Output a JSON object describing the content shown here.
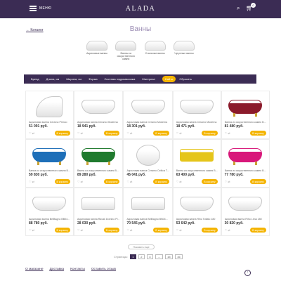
{
  "header": {
    "menu_label": "МЕНЮ",
    "logo": "ALADA",
    "cart_count": "0",
    "search_icon": "search-icon",
    "cart_icon": "cart-icon"
  },
  "breadcrumb": {
    "back_label": "← Каталог"
  },
  "page": {
    "title": "Ванны"
  },
  "categories": [
    {
      "label": "Акриловые ванны"
    },
    {
      "label": "Ванны из искусственного камня"
    },
    {
      "label": "Стальные ванны"
    },
    {
      "label": "Чугунные ванны"
    }
  ],
  "filters": {
    "items": [
      "Бренд",
      "Длина, см",
      "Ширина, см",
      "Форма",
      "Система гидромассажа",
      "Материал"
    ],
    "apply_label": "Найти",
    "reset_label": "Сбросить"
  },
  "products": [
    {
      "name": "Акриловая ванна Ceramo Plenco",
      "price": "51 091 руб.",
      "color": "#ffffff",
      "shape": "corner"
    },
    {
      "name": "Акриловая ванна Ceramo Moderna",
      "price": "18 941 руб.",
      "color": "#ffffff",
      "shape": "oval"
    },
    {
      "name": "Акриловая ванна Ceramo Moderna",
      "price": "18 301 руб.",
      "color": "#ffffff",
      "shape": "oval"
    },
    {
      "name": "Акриловая ванна Ceramo Moderna",
      "price": "18 471 руб.",
      "color": "#ffffff",
      "shape": "oval"
    },
    {
      "name": "Ванна из искусственного камня В...",
      "price": "81 480 руб.",
      "color": "#8b1a2b",
      "shape": "claw"
    },
    {
      "name": "Ванна из искусственного камня В...",
      "price": "59 830 руб.",
      "color": "#1e6fb8",
      "shape": "claw"
    },
    {
      "name": "Ванна из искусственного камня В...",
      "price": "89 280 руб.",
      "color": "#1f7a2e",
      "shape": "claw"
    },
    {
      "name": "Акриловая ванна Ceramo Celtica T...",
      "price": "45 041 руб.",
      "color": "#ffffff",
      "shape": "round"
    },
    {
      "name": "Ванна из искусственного камня В...",
      "price": "63 400 руб.",
      "color": "#e5c51a",
      "shape": "rect"
    },
    {
      "name": "Ванна из искусственного камня В...",
      "price": "77 780 руб.",
      "color": "#d8187a",
      "shape": "claw"
    },
    {
      "name": "Акриловая ванна BelBagno BB04...",
      "price": "88 780 руб.",
      "color": "#ffffff",
      "shape": "oval"
    },
    {
      "name": "Акриловая ванна Ravak Domino Pl...",
      "price": "28 030 руб.",
      "color": "#ffffff",
      "shape": "rect"
    },
    {
      "name": "Акриловая ванна BelBagno BB04...",
      "price": "70 545 руб.",
      "color": "#ffffff",
      "shape": "rect"
    },
    {
      "name": "Акриловая ванна Riho Totlato 180",
      "price": "53 642 руб.",
      "color": "#ffffff",
      "shape": "oval"
    },
    {
      "name": "Акриловая ванна Riho Lima 180",
      "price": "30 820 руб.",
      "color": "#ffffff",
      "shape": "oval"
    }
  ],
  "card": {
    "cart_label": "В корзину",
    "icons": "♡ ⇄"
  },
  "pagination": {
    "show_more_label": "Показать еще",
    "label": "Страницы:",
    "pages": [
      "1",
      "2",
      "3",
      "...",
      "15",
      "16"
    ]
  },
  "footer": {
    "links": [
      "О магазине",
      "Доставка",
      "Контакты",
      "Оставить отзыв"
    ],
    "up_label": "↑"
  },
  "colors": {
    "brand": "#3b2c54",
    "accent": "#f4b400"
  }
}
